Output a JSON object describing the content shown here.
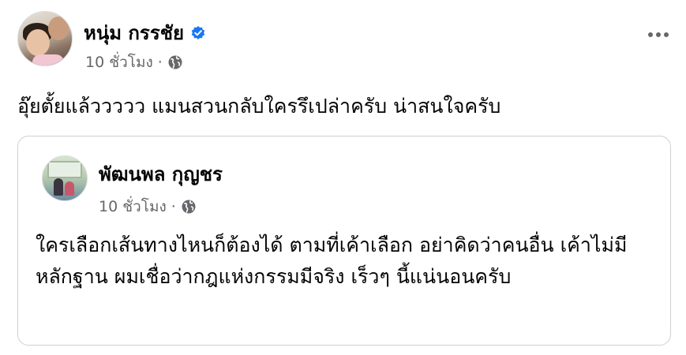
{
  "post": {
    "author": "หนุ่ม กรรชัย",
    "time": "10 ชั่วโมง",
    "separator": "·",
    "text": "อุ๊ยตั้ยแล้ววววว แมนสวนกลับใครรึเปล่าครับ น่าสนใจครับ",
    "icons": {
      "verified": "verified-badge-icon",
      "audience": "globe-icon",
      "menu": "more-options-icon"
    },
    "colors": {
      "verified": "#1877f2",
      "meta": "#65676b"
    }
  },
  "shared": {
    "author": "พัฒนพล กุญชร",
    "time": "10 ชั่วโมง",
    "separator": "·",
    "text": "ใครเลือกเส้นทางไหนก็ต้องได้ ตามที่เค้าเลือก อย่าคิดว่าคนอื่น เค้าไม่มี หลักฐาน ผมเชื่อว่ากฎแห่งกรรมมีจริง เร็วๆ นี้แน่นอนครับ",
    "icons": {
      "audience": "globe-icon"
    }
  }
}
